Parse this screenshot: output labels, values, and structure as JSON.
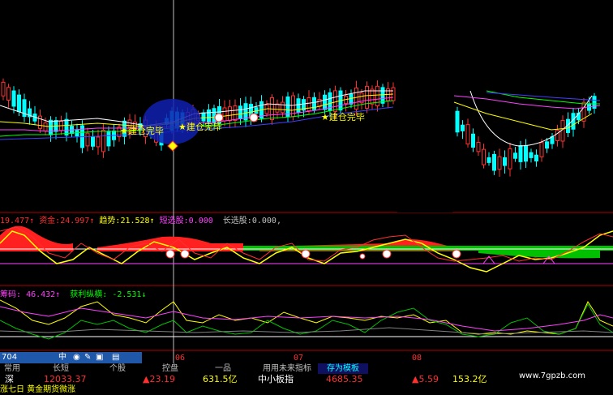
{
  "annotations": [
    {
      "text": "★建仓完毕"
    },
    {
      "text": "★建仓完毕"
    },
    {
      "text": "★建仓完毕"
    }
  ],
  "indicator1": {
    "prefix": "19.477↑",
    "fund_label": "资金:",
    "fund_value": "24.997↑",
    "trend_label": "趋势:",
    "trend_value": "21.528↑",
    "short_label": "短选股:",
    "short_value": "0.000",
    "long_label": "长选股:",
    "long_value": "0.000,"
  },
  "indicator2": {
    "chip_label": "筹码:",
    "chip_value": "46.432↑",
    "profit_label": "获利纵横:",
    "profit_value": "-2.531↓"
  },
  "dates": [
    "06",
    "07",
    "08"
  ],
  "toolbar": {
    "code": "704",
    "icons": [
      "中",
      "◉",
      "✎",
      "▣",
      "▤"
    ]
  },
  "tabs": [
    {
      "label": "常用"
    },
    {
      "label": "长短"
    },
    {
      "label": "个股"
    },
    {
      "label": "控盘"
    },
    {
      "label": "一品"
    },
    {
      "label": "用用未来指标"
    },
    {
      "label": "存为模板"
    }
  ],
  "ticker": [
    {
      "text": "深",
      "color": "#ffffff"
    },
    {
      "text": "12033.37",
      "color": "#ff3030"
    },
    {
      "text": "▲23.19",
      "color": "#ff3030"
    },
    {
      "text": "631.5亿",
      "color": "#ffff00"
    },
    {
      "text": "中小板指",
      "color": "#ffffff"
    },
    {
      "text": "4685.35",
      "color": "#ff3030"
    },
    {
      "text": "▲5.59",
      "color": "#ff3030"
    },
    {
      "text": "153.2亿",
      "color": "#ffff00"
    }
  ],
  "marquee": "涨七日 黄金期货微涨",
  "watermark": "www.7gpzb.com",
  "colors": {
    "up": "#ff3030",
    "down": "#00ffff",
    "accent": "#ffff00",
    "purple": "#ff40ff",
    "green": "#00c000"
  }
}
